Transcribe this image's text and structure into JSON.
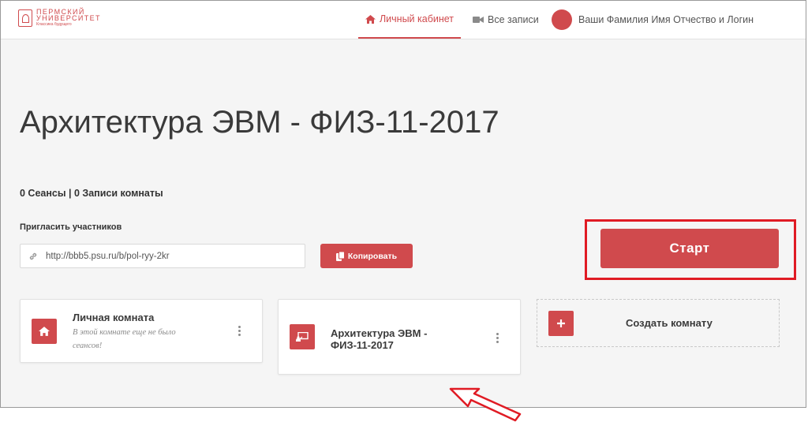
{
  "header": {
    "logo": {
      "line1": "ПЕРМСКИЙ",
      "line2": "УНИВЕРСИТЕТ",
      "line3": "Классика будущего"
    },
    "nav": {
      "cabinet_label": "Личный кабинет",
      "records_label": "Все записи",
      "user_label": "Ваши Фамилия Имя Отчество и Логин"
    }
  },
  "room": {
    "title": "Архитектура ЭВМ - ФИЗ-11-2017",
    "stats": "0 Сеансы | 0 Записи комнаты",
    "invite_label": "Пригласить участников",
    "invite_url": "http://bbb5.psu.ru/b/pol-ryy-2kr",
    "copy_label": "Копировать",
    "start_label": "Старт"
  },
  "rooms": {
    "home": {
      "title": "Личная комната",
      "subtitle": "В этой комнате еще не было сеансов!"
    },
    "arch": {
      "title": "Архитектура ЭВМ - ФИЗ-11-2017"
    },
    "create_label": "Создать комнату"
  },
  "colors": {
    "accent": "#d04a4d",
    "highlight": "#e01b24",
    "background": "#f5f5f5"
  }
}
